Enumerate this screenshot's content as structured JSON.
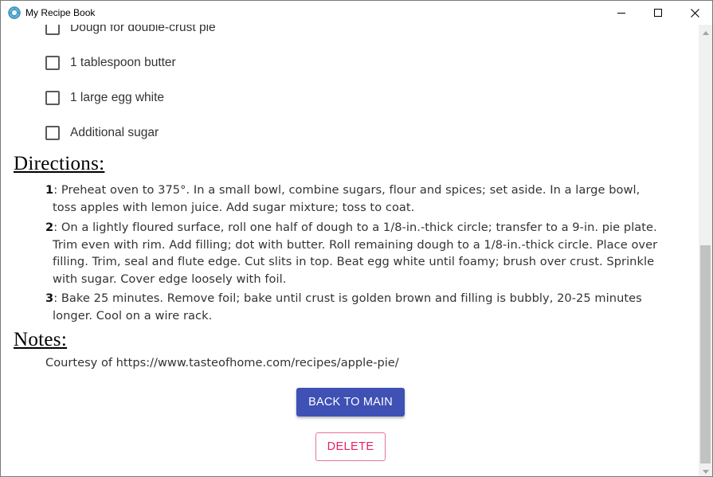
{
  "window": {
    "title": "My Recipe Book",
    "app_icon": "recipe-book-icon",
    "controls": [
      "minimize-icon",
      "maximize-icon",
      "close-icon"
    ]
  },
  "ingredients": [
    {
      "label": "Dough for double-crust pie",
      "checked": false
    },
    {
      "label": "1 tablespoon butter",
      "checked": false
    },
    {
      "label": "1 large egg white",
      "checked": false
    },
    {
      "label": "Additional sugar",
      "checked": false
    }
  ],
  "directions": {
    "heading": "Directions:",
    "steps": [
      {
        "num": "1",
        "text": ": Preheat oven to 375°. In a small bowl, combine sugars, flour and spices; set aside. In a large bowl, toss apples with lemon juice. Add sugar mixture; toss to coat."
      },
      {
        "num": "2",
        "text": ": On a lightly floured surface, roll one half of dough to a 1/8-in.-thick circle; transfer to a 9-in. pie plate. Trim even with rim. Add filling; dot with butter. Roll remaining dough to a 1/8-in.-thick circle. Place over filling. Trim, seal and flute edge. Cut slits in top. Beat egg white until foamy; brush over crust. Sprinkle with sugar. Cover edge loosely with foil."
      },
      {
        "num": "3",
        "text": ": Bake 25 minutes. Remove foil; bake until crust is golden brown and filling is bubbly, 20-25 minutes longer. Cool on a wire rack."
      }
    ]
  },
  "notes": {
    "heading": "Notes:",
    "text": "Courtesy of https://www.tasteofhome.com/recipes/apple-pie/"
  },
  "buttons": {
    "back_label": "BACK TO MAIN",
    "delete_label": "DELETE"
  },
  "colors": {
    "primary": "#3f51b5",
    "accent": "#e91e63"
  }
}
